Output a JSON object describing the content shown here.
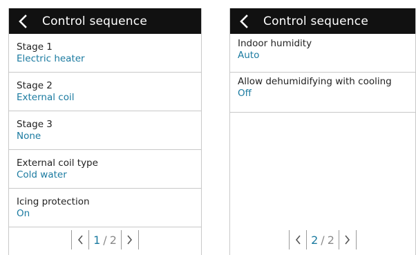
{
  "screens": [
    {
      "header": {
        "title": "Control sequence"
      },
      "items": [
        {
          "label": "Stage 1",
          "value": "Electric heater"
        },
        {
          "label": "Stage 2",
          "value": "External coil"
        },
        {
          "label": "Stage 3",
          "value": "None"
        },
        {
          "label": "External coil type",
          "value": "Cold water"
        },
        {
          "label": "Icing protection",
          "value": "On"
        }
      ],
      "pager": {
        "current": "1",
        "total": "2"
      }
    },
    {
      "header": {
        "title": "Control sequence"
      },
      "items": [
        {
          "label": "Indoor humidity",
          "value": "Auto"
        },
        {
          "label": "Allow dehumidifying with cooling",
          "value": "Off"
        }
      ],
      "pager": {
        "current": "2",
        "total": "2"
      }
    }
  ],
  "colors": {
    "header_bg": "#111111",
    "value_text": "#1a7aa0",
    "divider": "#c8c8c8"
  },
  "icons": {
    "back": "chevron-left-icon",
    "prev": "chevron-left-icon",
    "next": "chevron-right-icon"
  }
}
